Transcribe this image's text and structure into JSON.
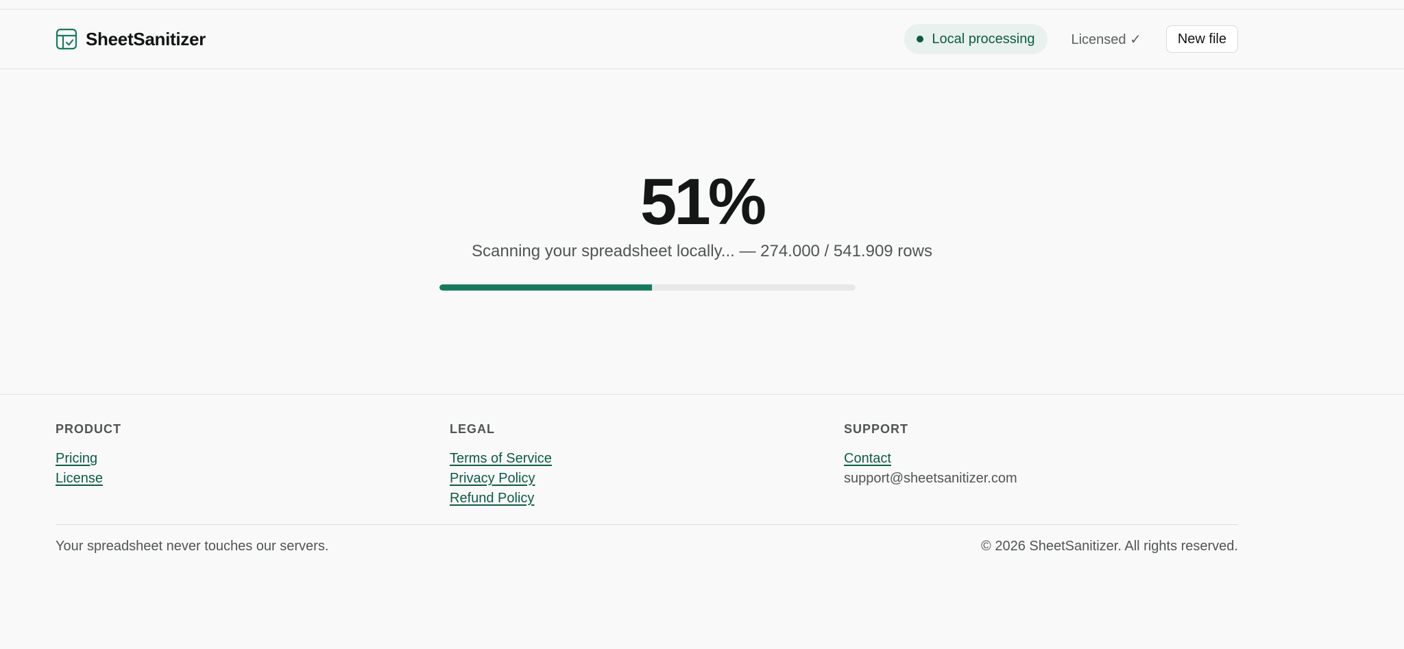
{
  "header": {
    "brand": "SheetSanitizer",
    "badge": "Local processing",
    "license_status": "Licensed ✓",
    "new_file_label": "New file"
  },
  "progress": {
    "percent_label": "51%",
    "percent_value": 51,
    "status_text": "Scanning your spreadsheet locally... — 274.000 / 541.909 rows",
    "processed_rows": "274.000",
    "total_rows": "541.909"
  },
  "footer": {
    "columns": [
      {
        "heading": "PRODUCT",
        "links": [
          "Pricing",
          "License"
        ]
      },
      {
        "heading": "LEGAL",
        "links": [
          "Terms of Service",
          "Privacy Policy",
          "Refund Policy"
        ]
      },
      {
        "heading": "SUPPORT",
        "links": [
          "Contact"
        ],
        "email": "support@sheetsanitizer.com"
      }
    ],
    "tagline": "Your spreadsheet never touches our servers.",
    "copyright": "© 2026 SheetSanitizer. All rights reserved."
  },
  "colors": {
    "accent": "#177a5e",
    "accent_dark": "#0e5a45",
    "badge_bg": "#e8f1ed",
    "background": "#f8f9f8"
  },
  "icons": {
    "brand": "spreadsheet-check-icon"
  }
}
